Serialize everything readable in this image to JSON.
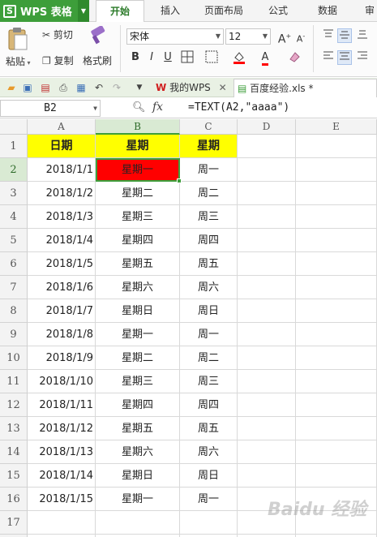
{
  "app": {
    "name": "WPS 表格",
    "logo_letter": "S"
  },
  "menu": {
    "tabs": [
      "开始",
      "插入",
      "页面布局",
      "公式",
      "数据",
      "审"
    ],
    "active_index": 0
  },
  "ribbon": {
    "paste_label": "粘贴",
    "cut_label": "剪切",
    "copy_label": "复制",
    "format_painter_label": "格式刷",
    "font_name": "宋体",
    "font_size": "12",
    "bold": "B",
    "italic": "I",
    "underline": "U",
    "font_color_letter": "A"
  },
  "doc_tabs": [
    {
      "label": "我的WPS",
      "active": false
    },
    {
      "label": "百度经验.xls *",
      "active": true
    }
  ],
  "formula_bar": {
    "name_box": "B2",
    "fx_label": "fx",
    "formula": "=TEXT(A2,\"aaaa\")"
  },
  "sheet": {
    "columns": [
      "A",
      "B",
      "C",
      "D",
      "E"
    ],
    "selected_column": "B",
    "selected_row": 2,
    "header_row": [
      "日期",
      "星期",
      "星期"
    ],
    "rows": [
      [
        "2018/1/1",
        "星期一",
        "周一"
      ],
      [
        "2018/1/2",
        "星期二",
        "周二"
      ],
      [
        "2018/1/3",
        "星期三",
        "周三"
      ],
      [
        "2018/1/4",
        "星期四",
        "周四"
      ],
      [
        "2018/1/5",
        "星期五",
        "周五"
      ],
      [
        "2018/1/6",
        "星期六",
        "周六"
      ],
      [
        "2018/1/7",
        "星期日",
        "周日"
      ],
      [
        "2018/1/8",
        "星期一",
        "周一"
      ],
      [
        "2018/1/9",
        "星期二",
        "周二"
      ],
      [
        "2018/1/10",
        "星期三",
        "周三"
      ],
      [
        "2018/1/11",
        "星期四",
        "周四"
      ],
      [
        "2018/1/12",
        "星期五",
        "周五"
      ],
      [
        "2018/1/13",
        "星期六",
        "周六"
      ],
      [
        "2018/1/14",
        "星期日",
        "周日"
      ],
      [
        "2018/1/15",
        "星期一",
        "周一"
      ]
    ],
    "row_numbers": [
      "1",
      "2",
      "3",
      "4",
      "5",
      "6",
      "7",
      "8",
      "9",
      "10",
      "11",
      "12",
      "13",
      "14",
      "15",
      "16",
      "17",
      "18"
    ]
  },
  "watermark": "Baidu 经验",
  "colors": {
    "accent": "#3d9e3a",
    "header_fill": "#ffff00",
    "highlight_fill": "#ff0000"
  }
}
